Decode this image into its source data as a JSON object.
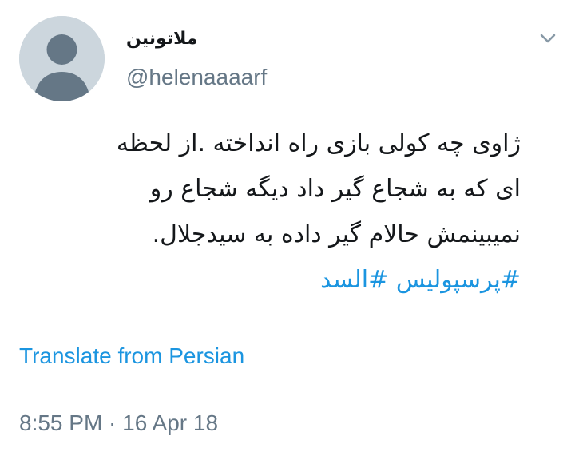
{
  "author": {
    "display_name": "ملاتونین",
    "handle": "@helenaaaarf",
    "avatar_icon": "default-user-avatar-icon"
  },
  "menu": {
    "icon": "chevron-down-icon"
  },
  "tweet": {
    "lines": [
      "ژاوی چه کولی بازی راه انداخته .از لحظه",
      "ای که به شجاع گیر داد دیگه شجاع رو",
      "نمیبینمش حالام گیر داده به سیدجلال."
    ],
    "hashtags": [
      "#پرسپولیس",
      "#السد"
    ]
  },
  "translate_label": "Translate from Persian",
  "timestamp": "8:55 PM · 16 Apr 18",
  "colors": {
    "link": "#1b95e0",
    "secondary_text": "#657786",
    "primary_text": "#14171a",
    "avatar_bg": "#ccd6dd",
    "avatar_fg": "#657786"
  }
}
